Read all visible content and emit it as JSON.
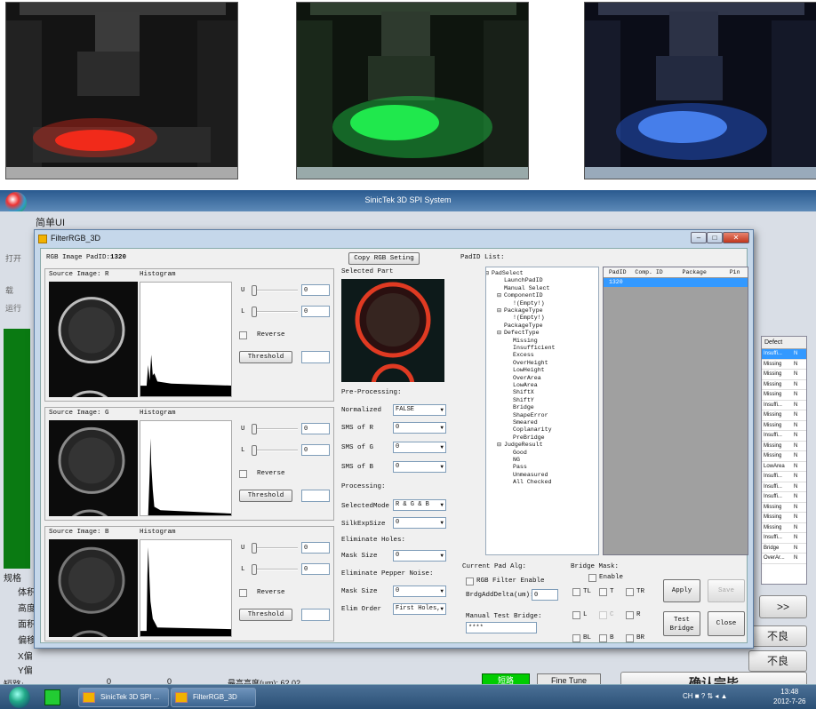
{
  "app": {
    "title": "SinicTek 3D SPI System",
    "simple_ui": "简单UI",
    "bg_tabs": [
      "打开",
      "载",
      "运行"
    ],
    "bg_labels": [
      "规格",
      "体积",
      "高度",
      "面积",
      "偏移",
      "X偏",
      "Y偏",
      "短路:"
    ],
    "short_vals": [
      "0",
      "0"
    ],
    "max_height": "最高高度(um): 62.02",
    "short_btn": "短路",
    "fine_tune": "Fine Tune",
    "next_btn": ">>",
    "bad1": "不良",
    "bad2": "不良",
    "confirm": "确认完毕",
    "defect_header": "Defect",
    "defects": [
      {
        "t": "Insuffi...",
        "v": "N"
      },
      {
        "t": "Missing",
        "v": "N"
      },
      {
        "t": "Missing",
        "v": "N"
      },
      {
        "t": "Missing",
        "v": "N"
      },
      {
        "t": "Missing",
        "v": "N"
      },
      {
        "t": "Insuffi...",
        "v": "N"
      },
      {
        "t": "Missing",
        "v": "N"
      },
      {
        "t": "Missing",
        "v": "N"
      },
      {
        "t": "Insuffi...",
        "v": "N"
      },
      {
        "t": "Missing",
        "v": "N"
      },
      {
        "t": "Missing",
        "v": "N"
      },
      {
        "t": "LowArea",
        "v": "N"
      },
      {
        "t": "Insuffi...",
        "v": "N"
      },
      {
        "t": "Insuffi...",
        "v": "N"
      },
      {
        "t": "Insuffi...",
        "v": "N"
      },
      {
        "t": "Missing",
        "v": "N"
      },
      {
        "t": "Missing",
        "v": "N"
      },
      {
        "t": "Missing",
        "v": "N"
      },
      {
        "t": "Insuffi...",
        "v": "N"
      },
      {
        "t": "Bridge",
        "v": "N"
      },
      {
        "t": "OverAr...",
        "v": "N"
      }
    ]
  },
  "dialog": {
    "title": "FilterRGB_3D",
    "rgb_padid_label": "RGB Image PadID:",
    "rgb_padid": "1320",
    "copy_btn": "Copy RGB Seting",
    "padid_list_label": "PadID List:",
    "channels": [
      {
        "source": "Source Image: R",
        "hist": "Histogram",
        "u": "0",
        "l": "0"
      },
      {
        "source": "Source Image: G",
        "hist": "Histogram",
        "u": "0",
        "l": "0"
      },
      {
        "source": "Source Image: B",
        "hist": "Histogram",
        "u": "0",
        "l": "0"
      }
    ],
    "u_label": "U",
    "l_label": "L",
    "reverse": "Reverse",
    "threshold": "Threshold",
    "selected_part": "Selected Part",
    "preprocessing": "Pre-Processing:",
    "normalized_label": "Normalized",
    "normalized_val": "FALSE",
    "sms_r_label": "SMS of R",
    "sms_r": "0",
    "sms_g_label": "SMS of G",
    "sms_g": "0",
    "sms_b_label": "SMS of B",
    "sms_b": "0",
    "processing": "Processing:",
    "selmode_label": "SelectedMode",
    "selmode": "R & G & B",
    "silk_label": "SilkExpSize",
    "silk": "0",
    "elim_holes": "Eliminate Holes:",
    "mask1_label": "Mask Size",
    "mask1": "0",
    "elim_pepper": "Eliminate Pepper Noise:",
    "mask2_label": "Mask Size",
    "mask2": "0",
    "elim_order_label": "Elim Order",
    "elim_order": "First Holes,",
    "tree": [
      {
        "t": "PadSelect",
        "d": 0
      },
      {
        "t": "LaunchPadID",
        "d": 1
      },
      {
        "t": "Manual Select",
        "d": 1
      },
      {
        "t": "ComponentID",
        "d": 1
      },
      {
        "t": "!(Empty!)",
        "d": 2
      },
      {
        "t": "PackageType",
        "d": 1
      },
      {
        "t": "!(Empty!)",
        "d": 2
      },
      {
        "t": "PackageType",
        "d": 1
      },
      {
        "t": "DefectType",
        "d": 1
      },
      {
        "t": "Missing",
        "d": 2
      },
      {
        "t": "Insufficient",
        "d": 2
      },
      {
        "t": "Excess",
        "d": 2
      },
      {
        "t": "OverHeight",
        "d": 2
      },
      {
        "t": "LowHeight",
        "d": 2
      },
      {
        "t": "OverArea",
        "d": 2
      },
      {
        "t": "LowArea",
        "d": 2
      },
      {
        "t": "ShiftX",
        "d": 2
      },
      {
        "t": "ShiftY",
        "d": 2
      },
      {
        "t": "Bridge",
        "d": 2
      },
      {
        "t": "ShapeError",
        "d": 2
      },
      {
        "t": "Smeared",
        "d": 2
      },
      {
        "t": "Coplanarity",
        "d": 2
      },
      {
        "t": "PreBridge",
        "d": 2
      },
      {
        "t": "JudgeResult",
        "d": 1
      },
      {
        "t": "Good",
        "d": 2
      },
      {
        "t": "NG",
        "d": 2
      },
      {
        "t": "Pass",
        "d": 2
      },
      {
        "t": "Unmeasured",
        "d": 2
      },
      {
        "t": "All Checked",
        "d": 2
      }
    ],
    "list_headers": [
      "PadID",
      "Comp. ID",
      "Package",
      "Pin"
    ],
    "list_rows": [
      "1320"
    ],
    "current_pad_alg": "Current Pad Alg:",
    "rgb_filter_enable": "RGB Filter Enable",
    "bridge_delta_label": "BrdgAddDelta(um):",
    "bridge_delta": "0",
    "manual_test_bridge": "Manual Test Bridge:",
    "manual_val": "****",
    "bridge_mask": "Bridge Mask:",
    "enable": "Enable",
    "mask_cells": [
      "TL",
      "T",
      "TR",
      "L",
      "C",
      "R",
      "BL",
      "B",
      "BR"
    ],
    "apply": "Apply",
    "save": "Save",
    "test_bridge_1": "Test",
    "test_bridge_2": "Bridge",
    "close": "Close"
  },
  "taskbar": {
    "item1": "SinicTek 3D SPI ...",
    "item2": "FilterRGB_3D",
    "tray_icons": "CH ■ ? ⇅ ◂ ▲",
    "time": "13:48",
    "date": "2012-7-26"
  },
  "photos": [
    {
      "color": "#ff2a1a"
    },
    {
      "color": "#22ff55"
    },
    {
      "color": "#2e6bff"
    }
  ]
}
